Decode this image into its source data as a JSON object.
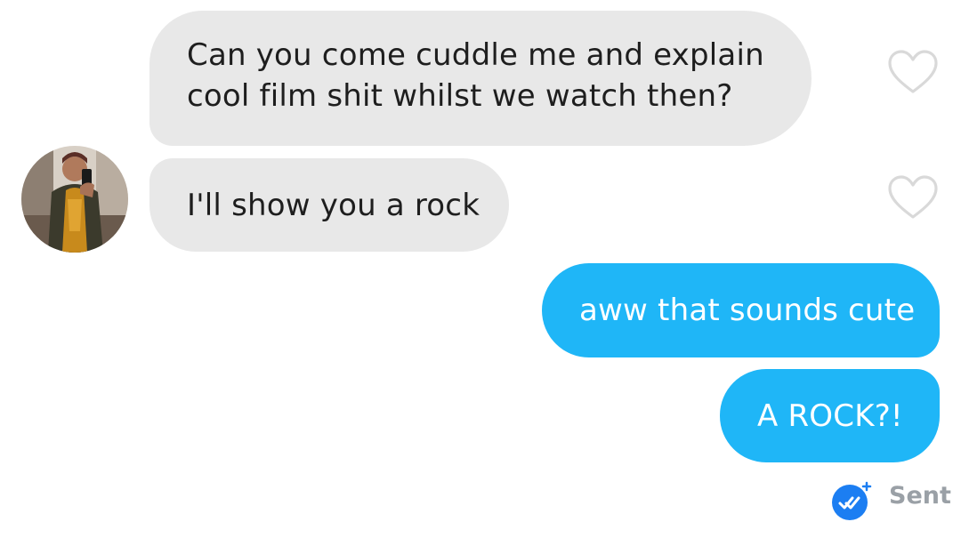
{
  "messages": [
    {
      "text": "Can you come cuddle me and explain cool film shit whilst we watch then?",
      "from": "match"
    },
    {
      "text": "I'll show you a rock",
      "from": "match"
    },
    {
      "text": "aww that sounds cute",
      "from": "me"
    },
    {
      "text": "A ROCK?!",
      "from": "me"
    }
  ],
  "status": {
    "label": "Sent"
  },
  "colors": {
    "incoming_bubble": "#e8e8e8",
    "outgoing_bubble": "#1fb6f7",
    "heart_outline": "#d9d9d9",
    "status_badge": "#1c7ef2",
    "status_text": "#9aa0a6"
  },
  "icons": {
    "like": "heart-outline-icon",
    "read_receipt": "double-check-icon"
  }
}
